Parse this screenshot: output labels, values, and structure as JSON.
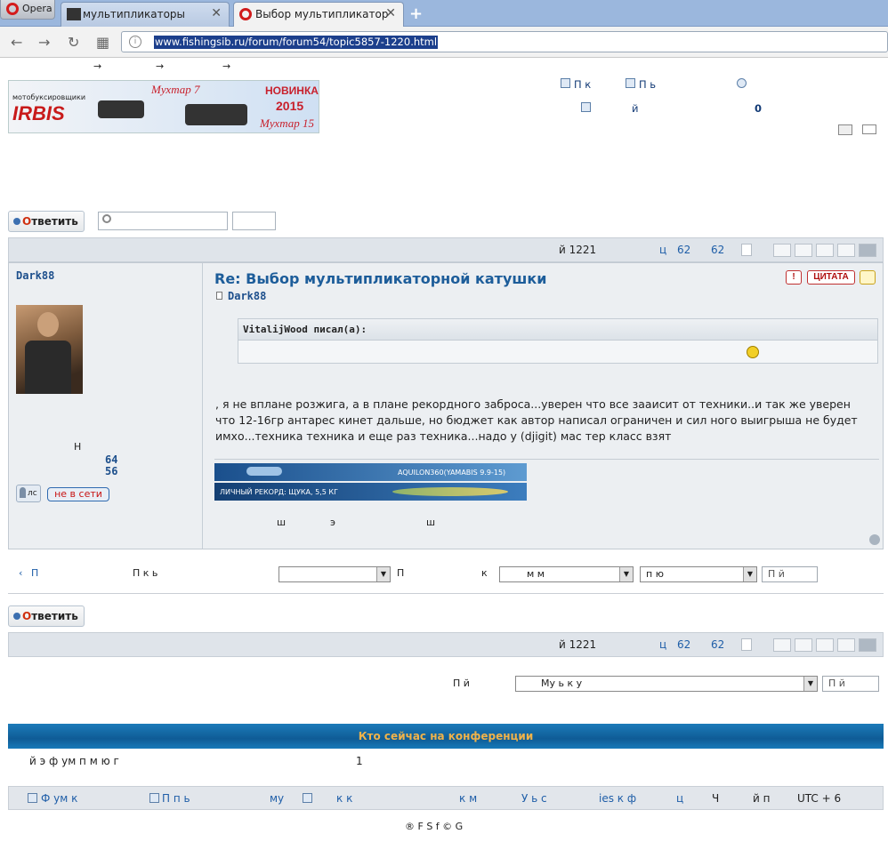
{
  "browser": {
    "opera_label": "Opera",
    "tabs": [
      {
        "title": "мультипликаторы",
        "close": "✕"
      },
      {
        "title": "Выбор мультипликаторной",
        "close": "✕"
      }
    ],
    "new_tab": "+",
    "nav": {
      "back": "←",
      "forward": "→",
      "reload": "↻",
      "speed_dial": "▦"
    },
    "url": "www.fishingsib.ru/forum/forum54/topic5857-1220.html"
  },
  "header": {
    "arrows": [
      "→",
      "→",
      "→"
    ],
    "banner": {
      "small": "мотобуксировщики",
      "brand": "IRBIS",
      "model1": "Мухтар 7",
      "new": "НОВИНКА",
      "year": "2015",
      "model2": "Мухтар 15"
    },
    "links_row1": [
      {
        "icon": "search-icon",
        "text": "П к"
      },
      {
        "icon": "doc-icon",
        "text": "П ь"
      }
    ],
    "links_row2": [
      {
        "icon": "user-icon",
        "text": "й"
      }
    ],
    "count": "0"
  },
  "toolbar": {
    "reply_prefix": "О",
    "reply_rest": "тветить",
    "search_placeholder": ""
  },
  "pagination": {
    "label": "й 1221",
    "label2": "ц",
    "page1": "62",
    "page2": "62"
  },
  "post": {
    "author": "Dark88",
    "title": "Re: Выбор мультипликаторной катушки",
    "post_author": "Dark88",
    "buttons": {
      "report": "!",
      "quote": "ЦИТАТА",
      "thumb": "👍"
    },
    "stats": {
      "label": "Н",
      "val1": "64",
      "val2": "56"
    },
    "ls_label": "лс",
    "offline_label": "не в сети",
    "quote_author": "VitalijWood писал(а):",
    "text": ", я не вплане розжига, а в плане рекордного заброса...уверен что все зааисит от техники..и так же уверен что 12-16гр антарес кинет дальше, но бюджет как автор написал ограничен и сил ного выигрыша не будет имхо...техника техника и еще раз техника...надо у (djigit) мас тер класс взят",
    "sig1": "AQUILON360(YAMABIS 9.9-15)",
    "sig2_left": "ЛИЧНЫЙ РЕКОРД: ЩУКА, 5,5 КГ",
    "bottom_text": [
      "ш",
      "э",
      "ш"
    ]
  },
  "postnav": {
    "prev_arrow": "‹",
    "prev": "П",
    "sort_label": "П к ь",
    "show_label": "П",
    "k_label": "к",
    "combo2": "м м",
    "combo3": "п ю",
    "go": "П й"
  },
  "jump": {
    "label": "П й",
    "select": "Му ь к у",
    "go": "П й"
  },
  "who": {
    "header": "Кто сейчас на конференции",
    "text": "й э ф ум п м ю г",
    "count": "1"
  },
  "footer": {
    "items": [
      "Ф ум к",
      "П п ь",
      "му",
      "к к",
      "к м",
      "У ь с",
      "ies к ф",
      "ц",
      "Ч",
      "й п",
      "UTC + 6"
    ],
    "copyright": "® F   S f   ©   G"
  },
  "colors": {
    "accent": "#1d5d9a",
    "reply": "#d03010",
    "banner_red": "#c8202c"
  }
}
